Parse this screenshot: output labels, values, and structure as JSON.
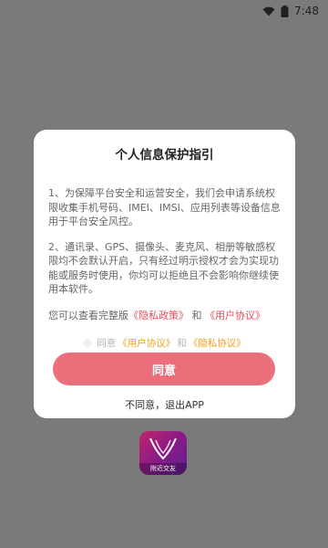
{
  "status_bar": {
    "time": "7:48",
    "wifi_icon": "wifi-icon",
    "battery_icon": "battery-icon"
  },
  "dialog": {
    "title": "个人信息保护指引",
    "paragraph1": "1、为保障平台安全和运营安全，我们会申请系统权限收集手机号码、IMEI、IMSI、应用列表等设备信息用于平台安全风控。",
    "paragraph2": "2、通讯录、GPS、摄像头、麦克风、相册等敏感权限均不会默认开启，只有经过明示授权才会为实现功能或服务时使用，你均可以拒绝且不会影响你继续使用本软件。",
    "links_prefix": "您可以查看完整版",
    "privacy_link": "《隐私政策》",
    "links_and": " 和 ",
    "user_link": "《用户协议》",
    "agree_prefix": "同意",
    "agree_user_link": "《用户协议》",
    "agree_and": "和",
    "agree_privacy_link": "《隐私协议》",
    "agree_button": "同意",
    "decline_button": "不同意，退出APP"
  },
  "app_logo": {
    "label": "附近交友"
  },
  "colors": {
    "overlay": "#7a7a7a",
    "accent_red": "#ea6f7b",
    "link_red": "#e74c5c",
    "link_gold": "#f0a21e"
  }
}
